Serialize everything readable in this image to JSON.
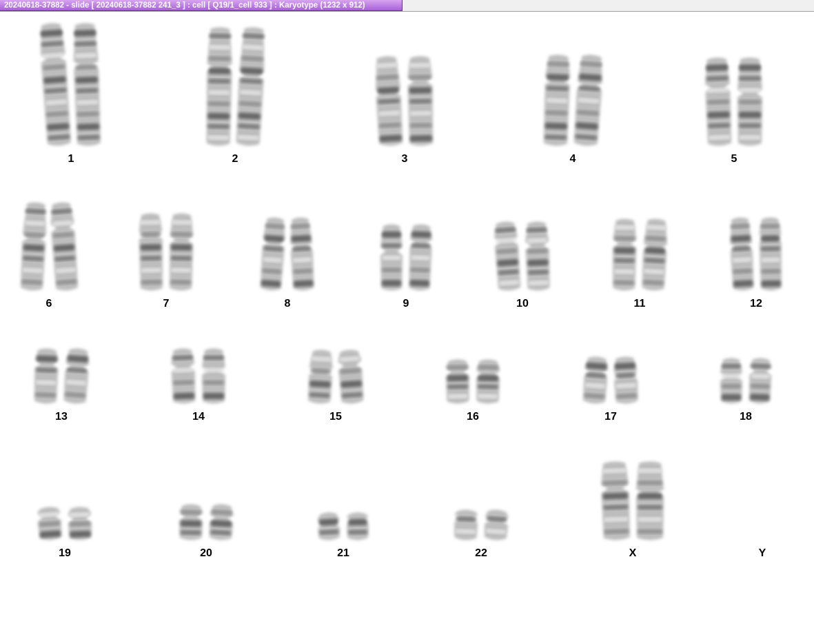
{
  "window": {
    "title": "20240618-37882 - slide [ 20240618-37882 241_3 ] : cell [ Q19/1_cell 933 ] : Karyotype  (1232 x 912)"
  },
  "karyotype": {
    "chromosomes": [
      {
        "label": "1",
        "copies": 2
      },
      {
        "label": "2",
        "copies": 2
      },
      {
        "label": "3",
        "copies": 2
      },
      {
        "label": "4",
        "copies": 2
      },
      {
        "label": "5",
        "copies": 2
      },
      {
        "label": "6",
        "copies": 2
      },
      {
        "label": "7",
        "copies": 2
      },
      {
        "label": "8",
        "copies": 2
      },
      {
        "label": "9",
        "copies": 2
      },
      {
        "label": "10",
        "copies": 2
      },
      {
        "label": "11",
        "copies": 2
      },
      {
        "label": "12",
        "copies": 2
      },
      {
        "label": "13",
        "copies": 2
      },
      {
        "label": "14",
        "copies": 2
      },
      {
        "label": "15",
        "copies": 2
      },
      {
        "label": "16",
        "copies": 2
      },
      {
        "label": "17",
        "copies": 2
      },
      {
        "label": "18",
        "copies": 2
      },
      {
        "label": "19",
        "copies": 2
      },
      {
        "label": "20",
        "copies": 2
      },
      {
        "label": "21",
        "copies": 2
      },
      {
        "label": "22",
        "copies": 2
      },
      {
        "label": "X",
        "copies": 2
      },
      {
        "label": "Y",
        "copies": 0
      }
    ]
  }
}
